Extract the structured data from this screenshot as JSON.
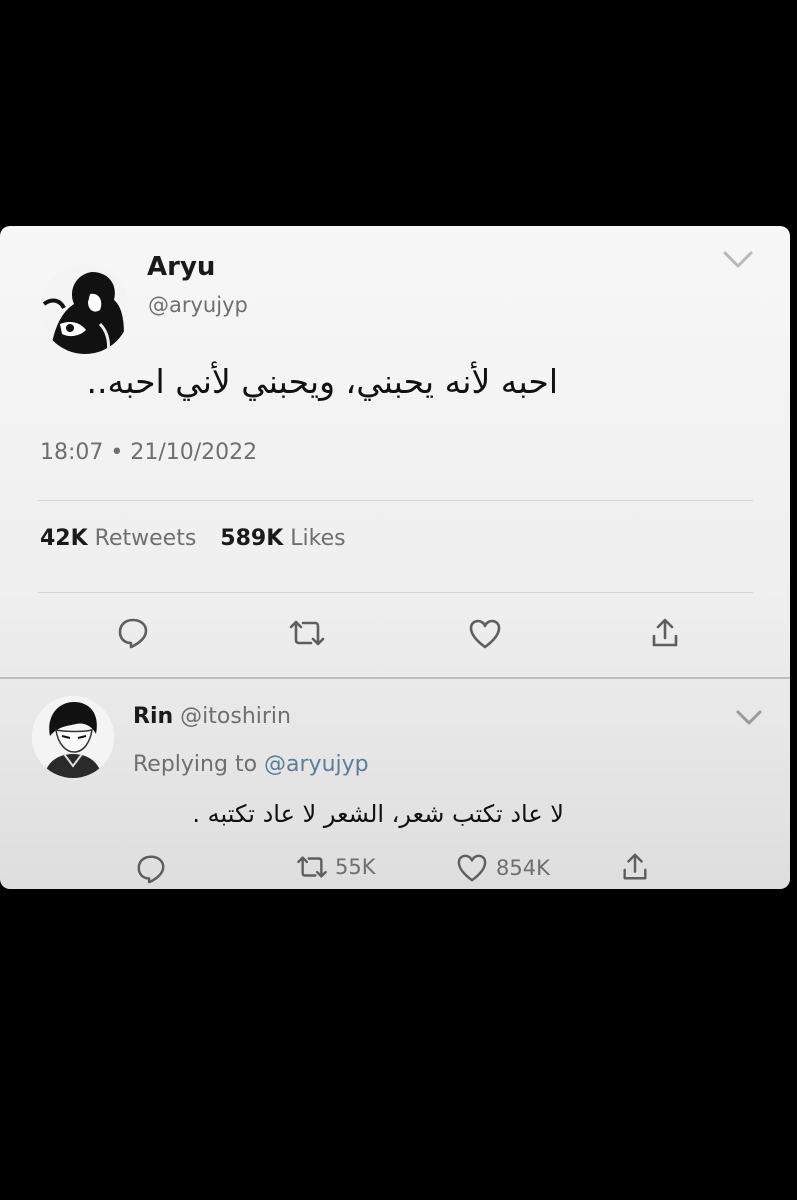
{
  "tweet": {
    "display_name": "Aryu",
    "handle": "@aryujyp",
    "text": "احبه لأنه يحبني، ويحبني لأني احبه..",
    "timestamp": "18:07 • 21/10/2022",
    "stats": {
      "retweets_count": "42K",
      "retweets_label": "Retweets",
      "likes_count": "589K",
      "likes_label": "Likes"
    },
    "actions": {
      "reply_icon": "speech-bubble-icon",
      "retweet_icon": "retweet-icon",
      "like_icon": "heart-icon",
      "share_icon": "share-icon"
    }
  },
  "reply": {
    "display_name": "Rin",
    "handle": "@itoshirin",
    "replying_prefix": "Replying to",
    "replying_handle": "@aryujyp",
    "text": "لا عاد تكتب شعر، الشعر لا عاد تكتبه .",
    "retweets_count": "55K",
    "likes_count": "854K"
  },
  "colors": {
    "background": "#000000",
    "card": "#f2f2f2",
    "muted_text": "#6f6f6f",
    "link": "#5b7e95"
  }
}
